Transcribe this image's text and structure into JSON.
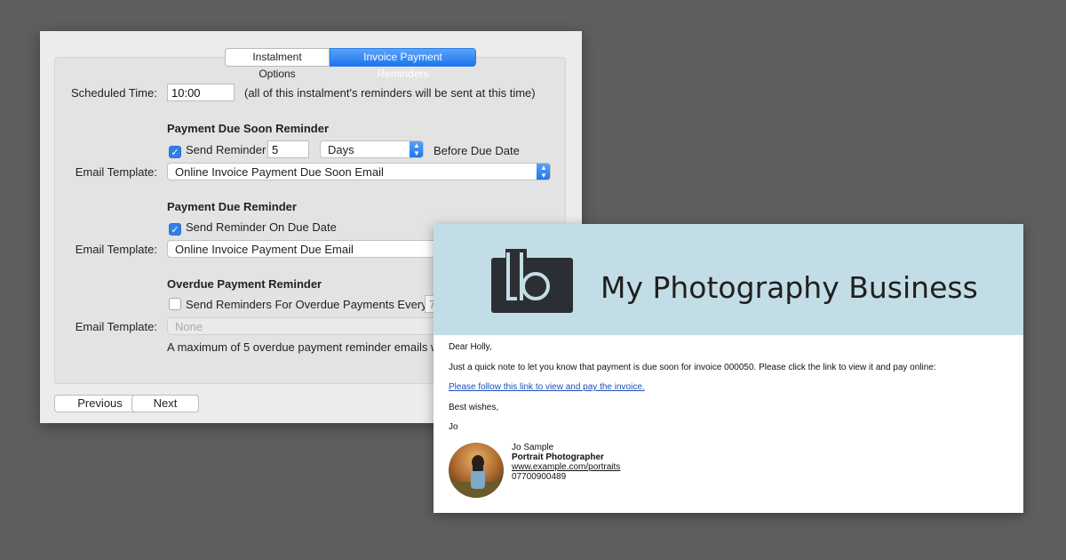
{
  "tabs": [
    {
      "label": "Instalment Options",
      "active": false
    },
    {
      "label": "Invoice Payment Reminders",
      "active": true
    }
  ],
  "scheduled": {
    "label": "Scheduled Time:",
    "value": "10:00",
    "note": "(all of this instalment's reminders will be sent at this time)"
  },
  "due_soon": {
    "heading": "Payment Due Soon Reminder",
    "checkbox_label": "Send Reminder",
    "checked": true,
    "days_value": "5",
    "unit": "Days",
    "after_label": "Before Due Date",
    "template_label": "Email Template:",
    "template": "Online Invoice Payment Due Soon Email"
  },
  "due": {
    "heading": "Payment Due Reminder",
    "checkbox_label": "Send Reminder On Due Date",
    "checked": true,
    "template_label": "Email Template:",
    "template": "Online Invoice Payment Due Email"
  },
  "overdue": {
    "heading": "Overdue Payment Reminder",
    "checkbox_label": "Send Reminders For Overdue Payments Every",
    "checked": false,
    "every_value": "7",
    "template_label": "Email Template:",
    "template": "None",
    "note": "A maximum of 5 overdue payment reminder emails w"
  },
  "nav": {
    "previous": "Previous",
    "next": "Next"
  },
  "email": {
    "brand": "My Photography Business",
    "greeting": "Dear Holly,",
    "body": "Just a quick note to let you know that payment is due soon for invoice 000050. Please click the link to view it and pay online:",
    "link": "Please follow this link to view and pay the invoice.",
    "closing": "Best wishes,",
    "sender_short": "Jo",
    "signature": {
      "name": "Jo Sample",
      "title": "Portrait Photographer",
      "website": "www.example.com/portraits",
      "phone": "07700900489"
    }
  },
  "colors": {
    "accent": "#2f7fe6",
    "banner": "#c3dde6",
    "logo": "#2b2f33",
    "link": "#1a4fb8"
  }
}
